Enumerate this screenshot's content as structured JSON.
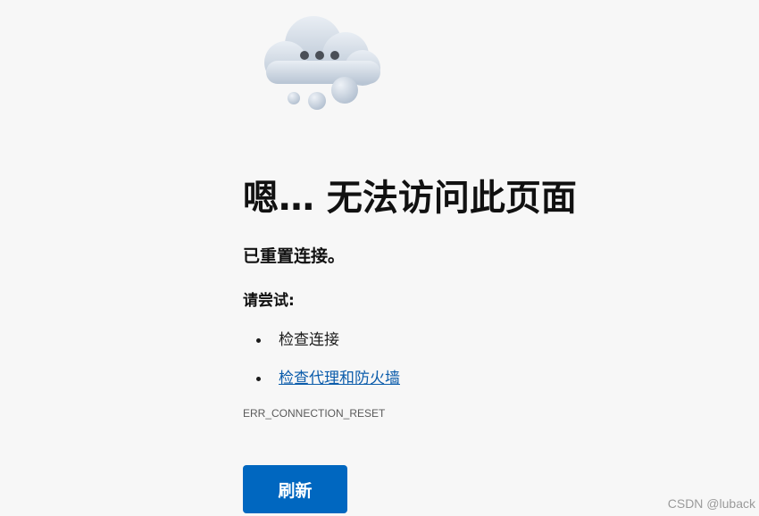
{
  "icon": "cloud-dots-icon",
  "title": "嗯… 无法访问此页面",
  "subtitle": "已重置连接。",
  "try_label": "请尝试:",
  "suggestions": [
    {
      "label": "检查连接",
      "is_link": false
    },
    {
      "label": "检查代理和防火墙",
      "is_link": true
    }
  ],
  "error_code": "ERR_CONNECTION_RESET",
  "refresh_label": "刷新",
  "watermark": "CSDN @luback",
  "colors": {
    "background": "#f7f7f7",
    "accent": "#0067c0",
    "link": "#0b5cab"
  }
}
